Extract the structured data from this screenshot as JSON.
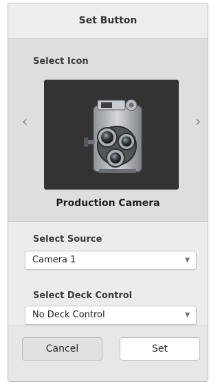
{
  "dialog": {
    "title": "Set Button"
  },
  "icon_section": {
    "label": "Select Icon",
    "selected_icon_name": "Production Camera",
    "icon": "movie-camera-icon",
    "prev_arrow": "‹",
    "next_arrow": "›"
  },
  "source_section": {
    "label": "Select Source",
    "selected": "Camera 1"
  },
  "deck_section": {
    "label": "Select Deck Control",
    "selected": "No Deck Control"
  },
  "buttons": {
    "cancel": "Cancel",
    "set": "Set"
  }
}
